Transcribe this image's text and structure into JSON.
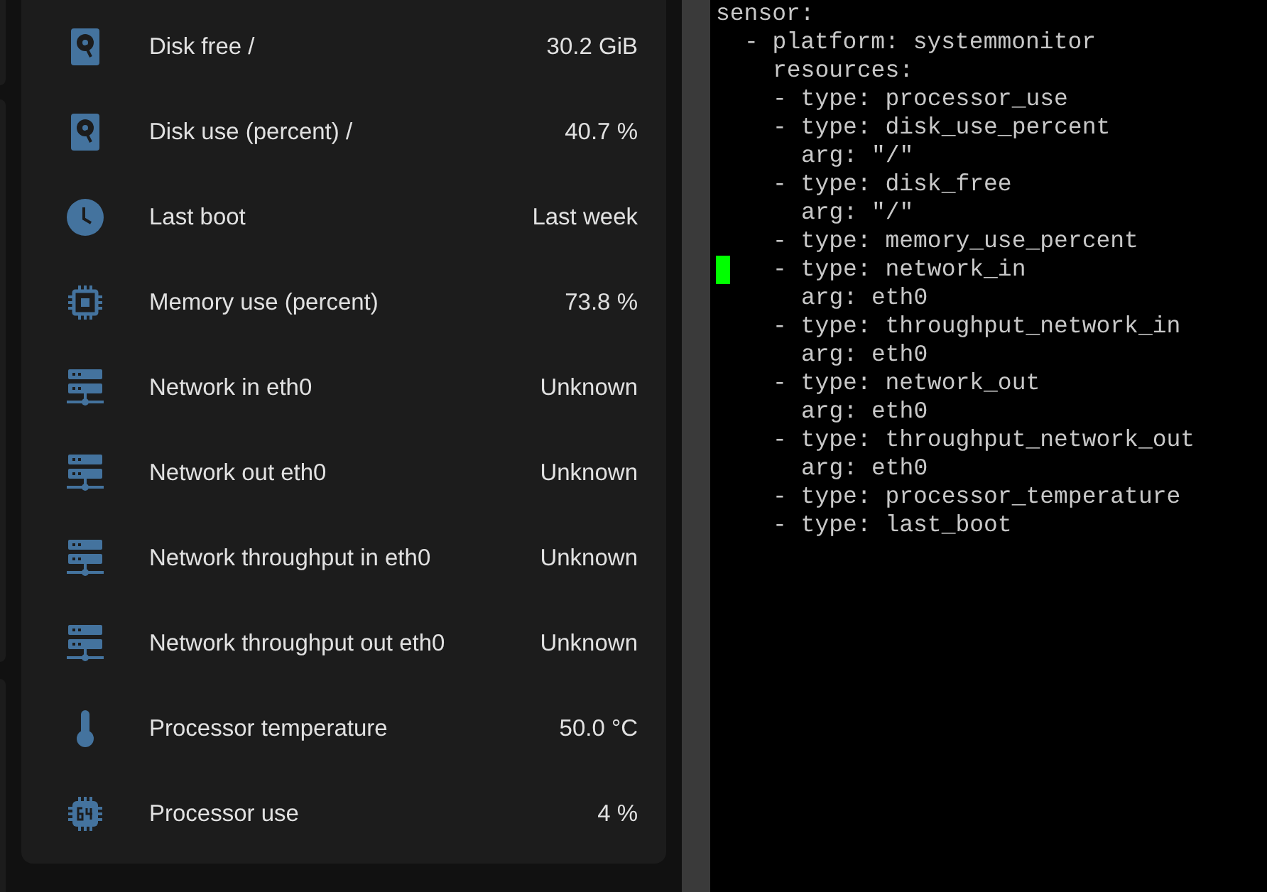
{
  "sensors": [
    {
      "kind": "disk",
      "name": "Disk free /",
      "value": "30.2 GiB"
    },
    {
      "kind": "disk",
      "name": "Disk use (percent) /",
      "value": "40.7 %"
    },
    {
      "kind": "clock",
      "name": "Last boot",
      "value": "Last week"
    },
    {
      "kind": "chip",
      "name": "Memory use (percent)",
      "value": "73.8 %"
    },
    {
      "kind": "network",
      "name": "Network in eth0",
      "value": "Unknown"
    },
    {
      "kind": "network",
      "name": "Network out eth0",
      "value": "Unknown"
    },
    {
      "kind": "network",
      "name": "Network throughput in eth0",
      "value": "Unknown"
    },
    {
      "kind": "network",
      "name": "Network throughput out eth0",
      "value": "Unknown"
    },
    {
      "kind": "thermometer",
      "name": "Processor temperature",
      "value": "50.0 °C"
    },
    {
      "kind": "cpu",
      "name": "Processor use",
      "value": "4 %"
    }
  ],
  "editor_lines": [
    {
      "text": "sensor:",
      "cursor": false
    },
    {
      "text": "  - platform: systemmonitor",
      "cursor": false
    },
    {
      "text": "    resources:",
      "cursor": false
    },
    {
      "text": "    - type: processor_use",
      "cursor": false
    },
    {
      "text": "    - type: disk_use_percent",
      "cursor": false
    },
    {
      "text": "      arg: \"/\"",
      "cursor": false
    },
    {
      "text": "    - type: disk_free",
      "cursor": false
    },
    {
      "text": "      arg: \"/\"",
      "cursor": false
    },
    {
      "text": "    - type: memory_use_percent",
      "cursor": false
    },
    {
      "text": "    - type: network_in",
      "cursor": true
    },
    {
      "text": "      arg: eth0",
      "cursor": false
    },
    {
      "text": "    - type: throughput_network_in",
      "cursor": false
    },
    {
      "text": "      arg: eth0",
      "cursor": false
    },
    {
      "text": "    - type: network_out",
      "cursor": false
    },
    {
      "text": "      arg: eth0",
      "cursor": false
    },
    {
      "text": "    - type: throughput_network_out",
      "cursor": false
    },
    {
      "text": "      arg: eth0",
      "cursor": false
    },
    {
      "text": "    - type: processor_temperature",
      "cursor": false
    },
    {
      "text": "    - type: last_boot",
      "cursor": false
    }
  ]
}
